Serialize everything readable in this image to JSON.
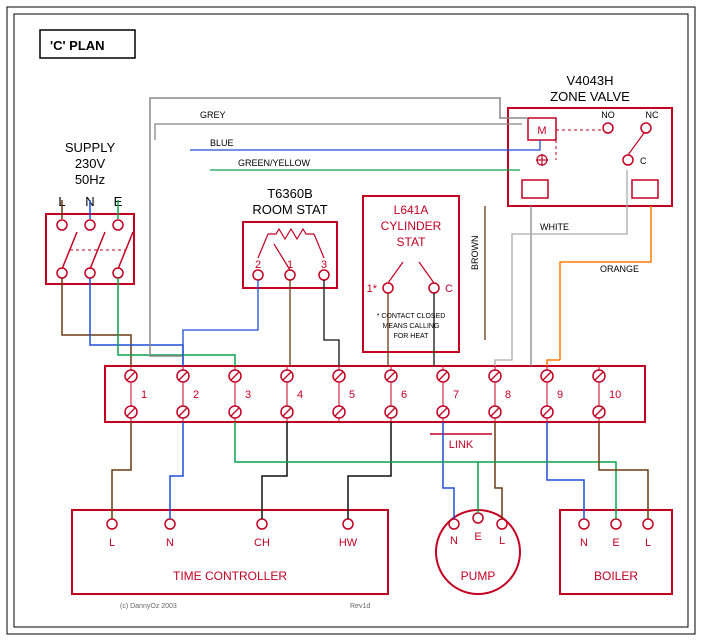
{
  "title": "'C' PLAN",
  "supply": {
    "label": "SUPPLY",
    "voltage": "230V",
    "freq": "50Hz",
    "terminals": [
      "L",
      "N",
      "E"
    ]
  },
  "room_stat": {
    "model": "T6360B",
    "name": "ROOM STAT",
    "terminals": [
      "2",
      "1",
      "3"
    ]
  },
  "cylinder_stat": {
    "model": "L641A",
    "name": "CYLINDER",
    "name2": "STAT",
    "t1": "1*",
    "tc": "C",
    "note1": "* CONTACT CLOSED",
    "note2": "MEANS CALLING",
    "note3": "FOR HEAT"
  },
  "zone_valve": {
    "model": "V4043H",
    "name": "ZONE VALVE",
    "motor": "M",
    "no": "NO",
    "nc": "NC",
    "c": "C"
  },
  "junction": {
    "count": 10,
    "link": "LINK"
  },
  "time_controller": {
    "name": "TIME CONTROLLER",
    "terminals": [
      "L",
      "N",
      "CH",
      "HW"
    ]
  },
  "pump": {
    "name": "PUMP",
    "terminals": [
      "N",
      "E",
      "L"
    ]
  },
  "boiler": {
    "name": "BOILER",
    "terminals": [
      "N",
      "E",
      "L"
    ]
  },
  "wire_colors": {
    "grey": "GREY",
    "blue": "BLUE",
    "green_yellow": "GREEN/YELLOW",
    "brown": "BROWN",
    "white": "WHITE",
    "orange": "ORANGE"
  },
  "credits": {
    "copyright": "(c) DannyOz 2003",
    "rev": "Rev1d"
  },
  "palette": {
    "red": "#c40022",
    "blue": "#1e4fd8",
    "green": "#0aa44a",
    "orange": "#ff7a00",
    "brown": "#6b3a12",
    "grey": "#888888",
    "black": "#111111",
    "outline": "#000000"
  }
}
